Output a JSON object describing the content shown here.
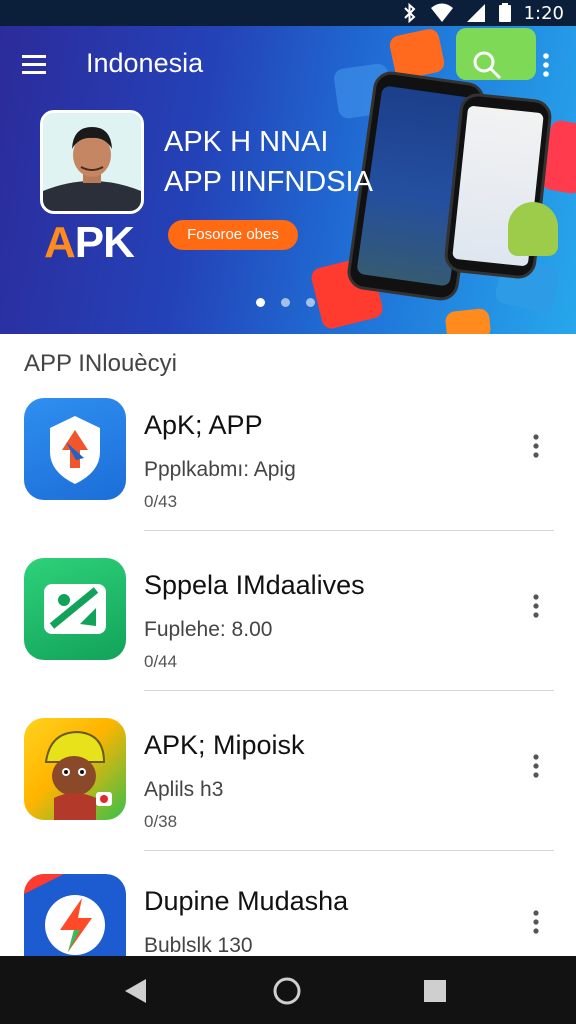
{
  "status_bar": {
    "time": "1:20",
    "icons": [
      "bluetooth-icon",
      "wifi-icon",
      "signal-icon",
      "battery-icon"
    ]
  },
  "app_bar": {
    "title": "Indonesia",
    "menu_icon": "hamburger-menu-icon",
    "search_icon": "search-icon",
    "more_icon": "more-vertical-icon"
  },
  "hero": {
    "headline_line1": "APK H NNAI",
    "headline_line2": "APP IINFNDSIA",
    "logo_a": "A",
    "logo_pk": "PK",
    "cta_label": "Fosoroe obes",
    "carousel": {
      "count": 3,
      "active": 0
    }
  },
  "section": {
    "title": "APP INlouècyi"
  },
  "apps": [
    {
      "name": "ApK; APP",
      "subtitle": "Ppplkabmı: Apig",
      "meta": "0/43",
      "icon": "shield-arrow-app-icon"
    },
    {
      "name": "Sppela IMdaalives",
      "subtitle": "Fuplehe: 8.00",
      "meta": "0/44",
      "icon": "green-image-app-icon"
    },
    {
      "name": "APK; Mipoisk",
      "subtitle": "Aplils h3",
      "meta": "0/38",
      "icon": "game-character-app-icon"
    },
    {
      "name": "Dupine Mudasha",
      "subtitle": "Bublslk 130",
      "meta": "",
      "icon": "lightning-app-icon"
    }
  ],
  "nav": {
    "back_icon": "back-triangle-icon",
    "home_icon": "home-circle-icon",
    "recents_icon": "recents-square-icon"
  },
  "colors": {
    "accent": "#ff6a13",
    "hero_start": "#2c2b9a",
    "hero_end": "#27a7ec",
    "status_bar": "#0b1f3a",
    "nav_bar": "#121212"
  }
}
